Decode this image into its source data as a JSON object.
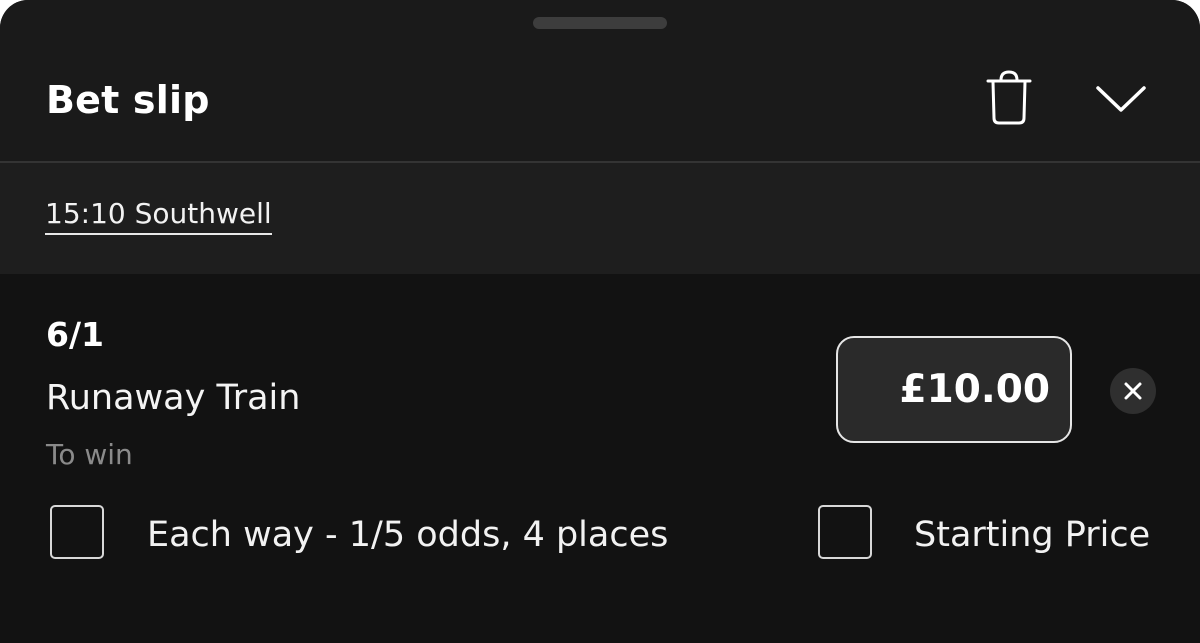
{
  "header": {
    "title": "Bet slip",
    "delete_icon": "trash-icon",
    "collapse_icon": "chevron-down-icon"
  },
  "event": {
    "name": "15:10 Southwell"
  },
  "bet": {
    "odds": "6/1",
    "selection": "Runaway Train",
    "market": "To win",
    "stake": "£10.00",
    "remove_icon": "close-icon"
  },
  "options": {
    "each_way": {
      "label": "Each way - 1/5 odds, 4 places",
      "checked": false
    },
    "starting_price": {
      "label": "Starting Price",
      "checked": false
    }
  },
  "colors": {
    "background": "#121212",
    "header_background": "#1a1a1a",
    "event_bar_background": "#1e1e1e",
    "text_primary": "#ffffff",
    "text_secondary": "#8a8a8a",
    "input_background": "#2a2a2a"
  }
}
